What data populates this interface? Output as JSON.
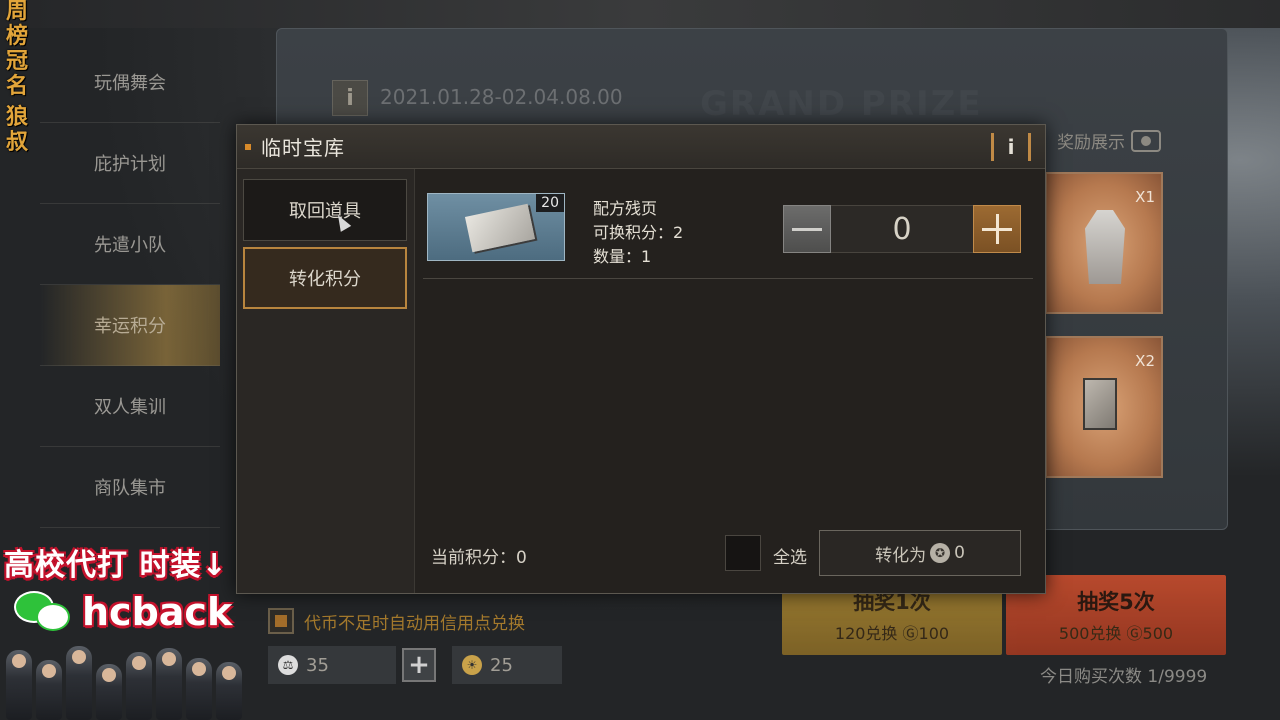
{
  "side_ribbon": {
    "chars": [
      "周",
      "榜",
      "冠",
      "名",
      "狼",
      "叔"
    ]
  },
  "nav": {
    "items": [
      {
        "label": "玩偶舞会"
      },
      {
        "label": "庇护计划"
      },
      {
        "label": "先遣小队"
      },
      {
        "label": "幸运积分"
      },
      {
        "label": "双人集训"
      },
      {
        "label": "商队集市"
      }
    ],
    "active_index": 3
  },
  "event": {
    "date_range": "2021.01.28-02.04.08.00",
    "bg_title": "GRAND PRIZE",
    "reward_show_label": "奖励展示",
    "reward_cards": [
      {
        "mult": "X1"
      },
      {
        "mult": "X2"
      }
    ],
    "auto_exchange_label": "代币不足时自动用信用点兑换",
    "currency_a": "35",
    "currency_b": "25",
    "draw_one": {
      "title": "抽奖1次",
      "cost": "120兑换",
      "cost_b": "100"
    },
    "draw_five": {
      "title": "抽奖5次",
      "cost": "500兑换",
      "cost_b": "500"
    },
    "daily_count": "今日购买次数 1/9999"
  },
  "modal": {
    "title": "临时宝库",
    "info_glyph": "i",
    "tabs": {
      "retrieve": "取回道具",
      "convert": "转化积分"
    },
    "item": {
      "count": "20",
      "name": "配方残页",
      "points_line": "可换积分：2",
      "qty_line": "数量：1"
    },
    "stepper_value": "0",
    "current_points": "当前积分：0",
    "select_all": "全选",
    "convert_prefix": "转化为",
    "convert_value": "0"
  },
  "overlay": {
    "line1": "高校代打 时装↓",
    "handle": "hcback"
  },
  "colors": {
    "accent_orange": "#d88a2a",
    "tab_active_border": "#b8853e",
    "overlay_red": "#c4122c"
  }
}
